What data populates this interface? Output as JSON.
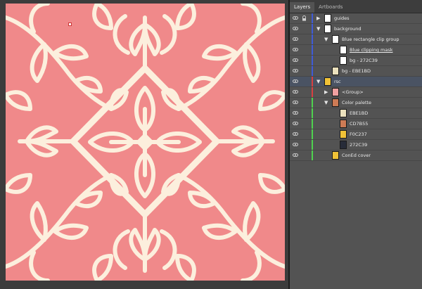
{
  "panel": {
    "tabs": [
      "Layers",
      "Artboards"
    ],
    "active_tab": "Layers"
  },
  "colors": {
    "pattern_bg": "#F0898A",
    "pattern_line": "#FCEFDD",
    "layer_blue": "#3f5bd6",
    "layer_red": "#d84040",
    "layer_green": "#4fd24f",
    "selected_row": "#4a5363"
  },
  "layers": [
    {
      "label": "guides",
      "indent": 0,
      "expanded": false,
      "thumb": "#ffffff",
      "bar": "blue",
      "locked": true
    },
    {
      "label": "background",
      "indent": 0,
      "expanded": true,
      "thumb": "#ffffff",
      "bar": "blue",
      "locked": false
    },
    {
      "label": "Blue rectangle clip group",
      "indent": 1,
      "expanded": true,
      "thumb": "#ffffff",
      "bar": "blue",
      "locked": false
    },
    {
      "label": "Blue clipping mask",
      "indent": 2,
      "expanded": null,
      "thumb": "#ffffff",
      "bar": "blue",
      "locked": false,
      "underline": true
    },
    {
      "label": "bg - 272C39",
      "indent": 2,
      "expanded": null,
      "thumb": "#ffffff",
      "bar": "blue",
      "locked": false
    },
    {
      "label": "bg - EBE1BD",
      "indent": 1,
      "expanded": null,
      "thumb": "#EBE1BD",
      "bar": "blue",
      "locked": false
    },
    {
      "label": "rsc",
      "indent": 0,
      "expanded": true,
      "thumb": "#F0C237",
      "bar": "red",
      "locked": false,
      "selected": true
    },
    {
      "label": "<Group>",
      "indent": 1,
      "expanded": false,
      "thumb": "#F0A0A0",
      "bar": "red",
      "locked": false
    },
    {
      "label": "Color palette",
      "indent": 1,
      "expanded": true,
      "thumb": "#CD7B55",
      "bar": "green",
      "locked": false
    },
    {
      "label": "EBE1BD",
      "indent": 2,
      "expanded": null,
      "thumb": "#EBE1BD",
      "bar": "green",
      "locked": false
    },
    {
      "label": "CD7B55",
      "indent": 2,
      "expanded": null,
      "thumb": "#CD7B55",
      "bar": "green",
      "locked": false
    },
    {
      "label": "F0C237",
      "indent": 2,
      "expanded": null,
      "thumb": "#F0C237",
      "bar": "green",
      "locked": false
    },
    {
      "label": "272C39",
      "indent": 2,
      "expanded": null,
      "thumb": "#272C39",
      "bar": "green",
      "locked": false
    },
    {
      "label": "ConEd cover",
      "indent": 1,
      "expanded": null,
      "thumb": "#F0C237",
      "bar": "green",
      "locked": false
    }
  ]
}
